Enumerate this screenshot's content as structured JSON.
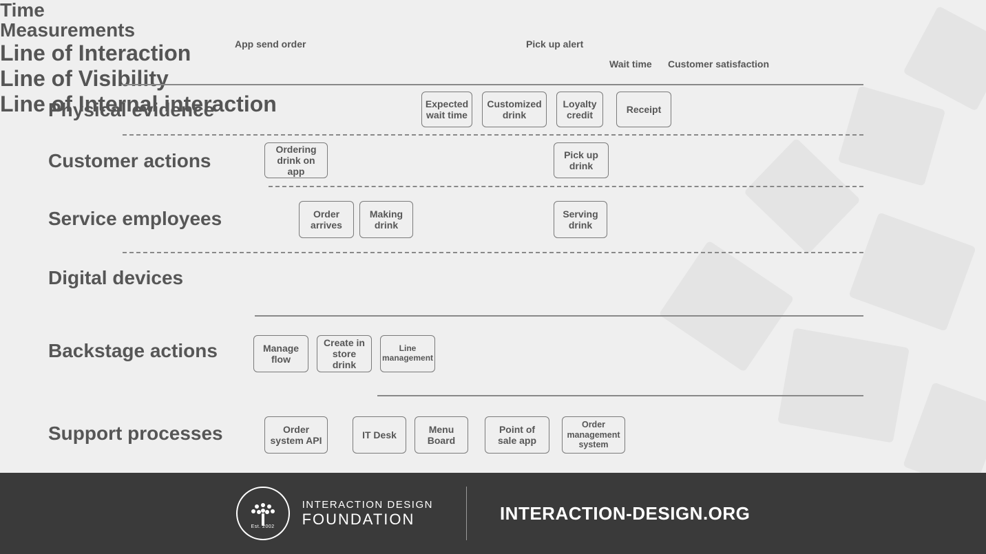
{
  "title": "Time\nMeasurements",
  "timeLabels": {
    "appSend": "App send order",
    "pickupAlert": "Pick up alert",
    "waitTime": "Wait time",
    "custSat": "Customer satisfaction"
  },
  "rows": {
    "physicalEvidence": {
      "label": "Physical evidence",
      "boxes": {
        "expectedWait": "Expected wait time",
        "customDrink": "Customized drink",
        "loyalty": "Loyalty credit",
        "receipt": "Receipt"
      }
    },
    "customerActions": {
      "label": "Customer actions",
      "boxes": {
        "ordering": "Ordering drink on app",
        "pickup": "Pick up drink"
      }
    },
    "lineInteraction": "Line of Interaction",
    "serviceEmployees": {
      "label": "Service employees",
      "boxes": {
        "orderArrives": "Order arrives",
        "making": "Making drink",
        "serving": "Serving drink"
      }
    },
    "digitalDevices": {
      "label": "Digital devices"
    },
    "lineVisibility": "Line of Visibility",
    "backstage": {
      "label": "Backstage actions",
      "boxes": {
        "manageFlow": "Manage flow",
        "createStore": "Create in store drink",
        "lineMgmt": "Line management"
      }
    },
    "lineInternal": "Line of Internal interaction",
    "support": {
      "label": "Support processes",
      "boxes": {
        "api": "Order system API",
        "it": "IT Desk",
        "menu": "Menu Board",
        "pos": "Point of sale app",
        "oms": "Order management system"
      }
    }
  },
  "footer": {
    "brand1": "INTERACTION DESIGN",
    "brand2": "FOUNDATION",
    "est": "Est. 2002",
    "url": "INTERACTION-DESIGN.ORG"
  }
}
